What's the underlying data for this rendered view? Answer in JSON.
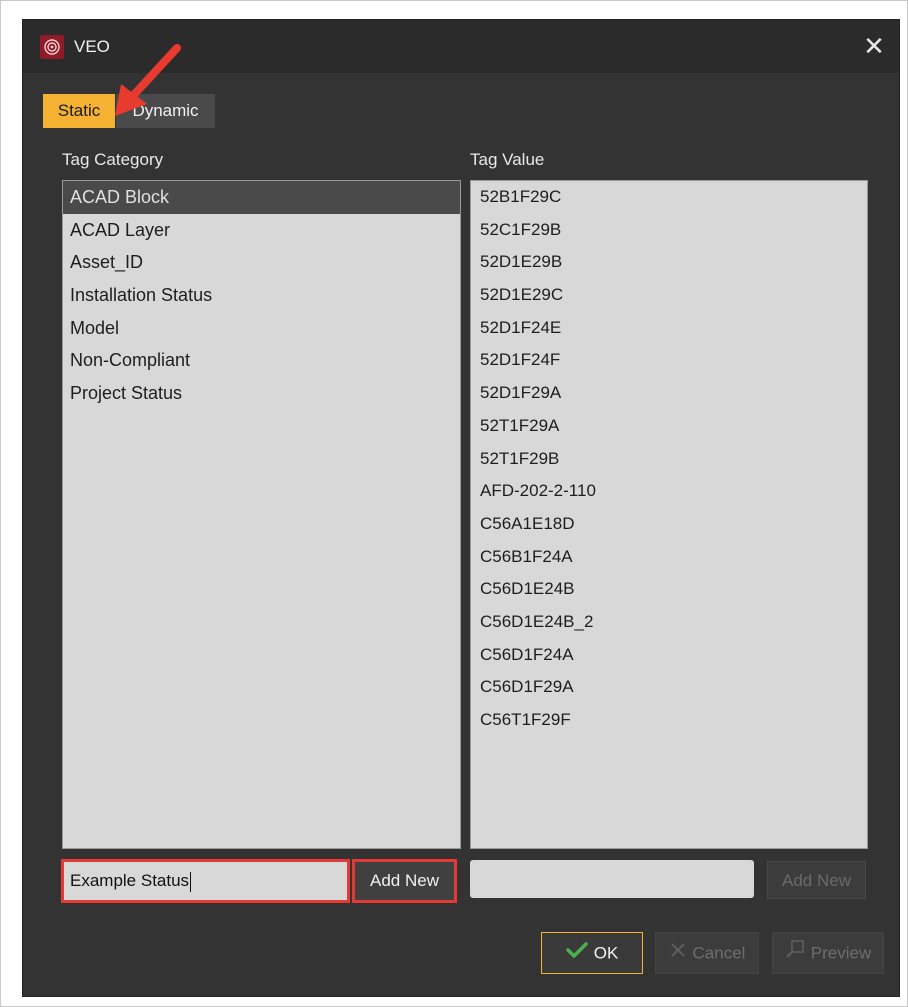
{
  "window": {
    "title": "VEO"
  },
  "tabs": [
    {
      "label": "Static",
      "active": true
    },
    {
      "label": "Dynamic",
      "active": false
    }
  ],
  "left": {
    "label": "Tag Category",
    "items": [
      "ACAD Block",
      "ACAD Layer",
      "Asset_ID",
      "Installation Status",
      "Model",
      "Non-Compliant",
      "Project Status"
    ],
    "selected": "ACAD Block",
    "input_value": "Example Status",
    "add_label": "Add New"
  },
  "right": {
    "label": "Tag Value",
    "items": [
      "52B1F29C",
      "52C1F29B",
      "52D1E29B",
      "52D1E29C",
      "52D1F24E",
      "52D1F24F",
      "52D1F29A",
      "52T1F29A",
      "52T1F29B",
      "AFD-202-2-110",
      "C56A1E18D",
      "C56B1F24A",
      "C56D1E24B",
      "C56D1E24B_2",
      "C56D1F24A",
      "C56D1F29A",
      "C56T1F29F"
    ],
    "input_value": "",
    "add_label": "Add New"
  },
  "footer": {
    "ok": "OK",
    "cancel": "Cancel",
    "preview": "Preview"
  },
  "colors": {
    "accent": "#f5b132",
    "highlight": "#e53935",
    "dialog_bg": "#333333",
    "app_icon": "#8e1b25"
  },
  "icons": {
    "app": "veo-logo-icon",
    "close": "close-icon",
    "ok": "check-icon",
    "cancel": "x-icon",
    "preview": "preview-icon"
  }
}
